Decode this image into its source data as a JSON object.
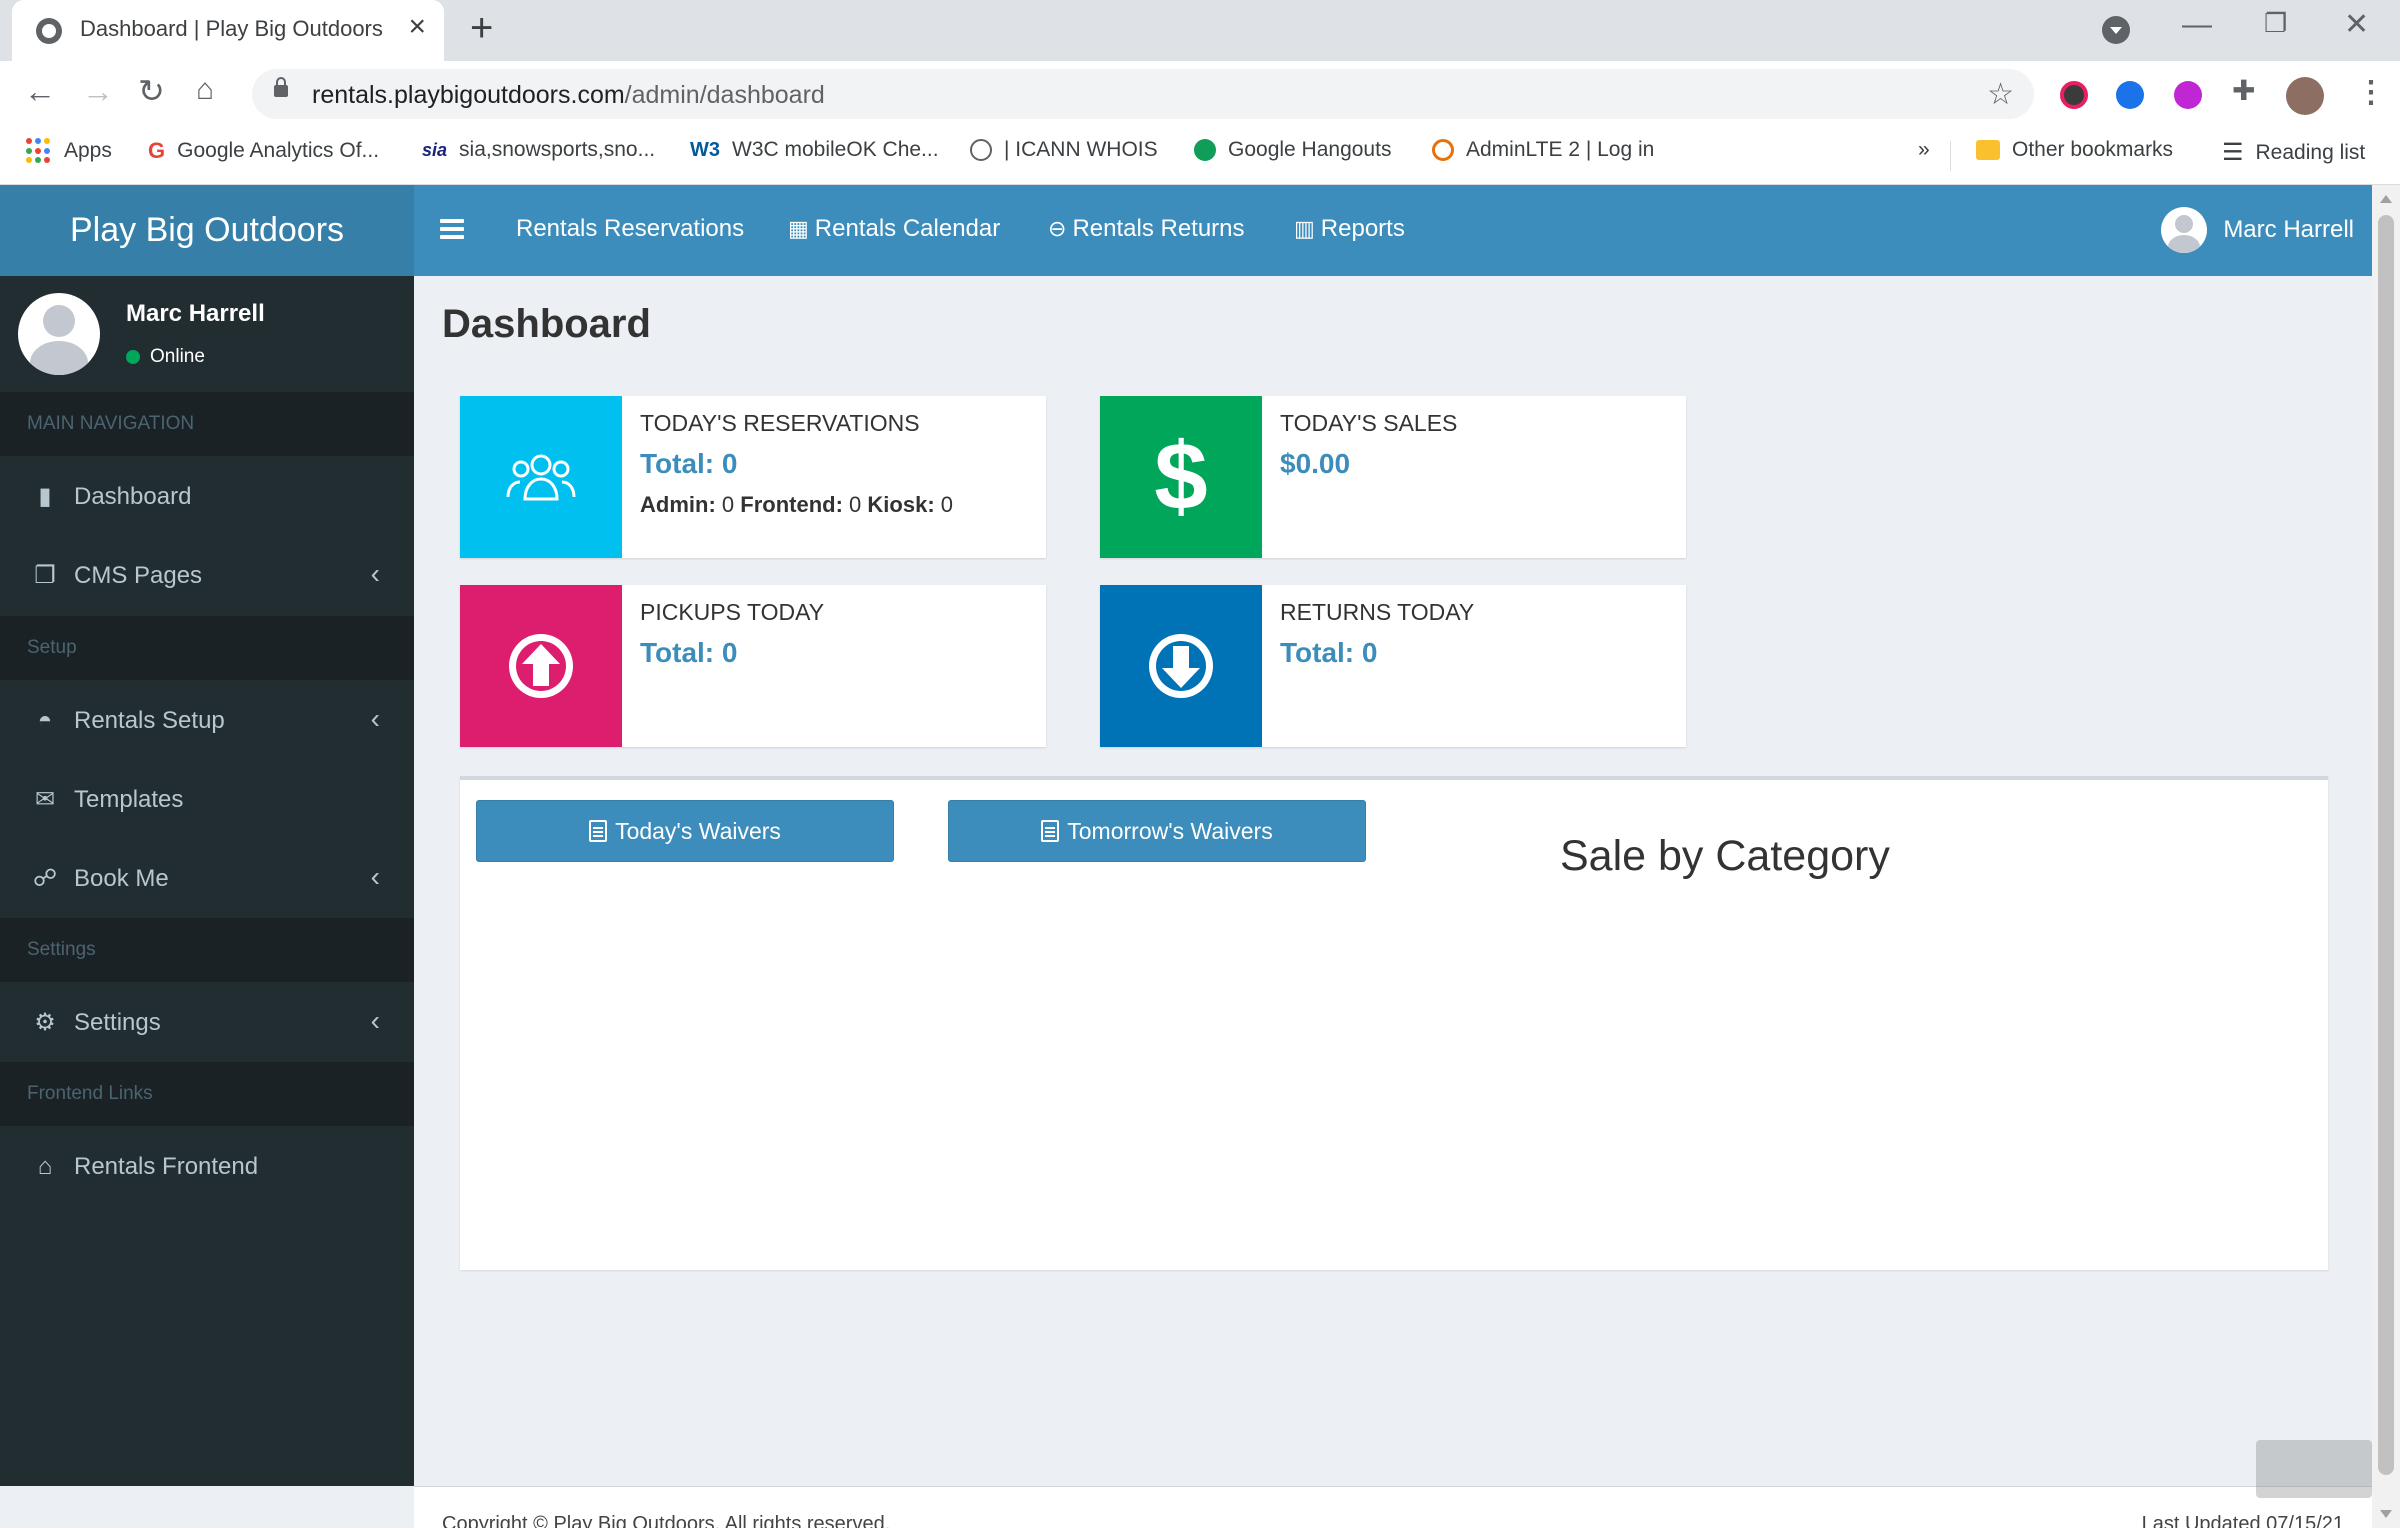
{
  "browser": {
    "tab_title": "Dashboard | Play Big Outdoors",
    "url_host": "rentals.playbigoutdoors.com",
    "url_path": "/admin/dashboard",
    "bookmarks": [
      {
        "label": "Apps",
        "icon": "apps-grid-icon"
      },
      {
        "label": "Google Analytics Of...",
        "icon": "google-icon"
      },
      {
        "label": "sia,snowsports,sno...",
        "icon": "sia-icon"
      },
      {
        "label": "W3C mobileOK Che...",
        "icon": "w3c-icon"
      },
      {
        "label": "| ICANN WHOIS",
        "icon": "icann-icon"
      },
      {
        "label": "Google Hangouts",
        "icon": "hangouts-icon"
      },
      {
        "label": "AdminLTE 2 | Log in",
        "icon": "adminlte-icon"
      }
    ],
    "overflow": "»",
    "other_bookmarks": "Other bookmarks",
    "reading_list": "Reading list"
  },
  "app": {
    "logo": "Play Big Outdoors",
    "topnav": [
      {
        "label": "Rentals Reservations",
        "icon": ""
      },
      {
        "label": "Rentals Calendar",
        "icon": "calendar-icon"
      },
      {
        "label": "Rentals Returns",
        "icon": "return-circle-icon"
      },
      {
        "label": "Reports",
        "icon": "bar-chart-icon"
      }
    ],
    "user_name": "Marc Harrell"
  },
  "sidebar": {
    "user_name": "Marc Harrell",
    "status": "Online",
    "sections": [
      {
        "header": "MAIN NAVIGATION",
        "items": [
          {
            "label": "Dashboard",
            "icon": "book-icon",
            "has_children": false
          },
          {
            "label": "CMS Pages",
            "icon": "copy-icon",
            "has_children": true
          }
        ]
      },
      {
        "header": "Setup",
        "items": [
          {
            "label": "Rentals Setup",
            "icon": "dashboard-gauge-icon",
            "has_children": true
          },
          {
            "label": "Templates",
            "icon": "envelope-icon",
            "has_children": false
          },
          {
            "label": "Book Me",
            "icon": "handshake-icon",
            "has_children": true
          }
        ]
      },
      {
        "header": "Settings",
        "items": [
          {
            "label": "Settings",
            "icon": "gear-icon",
            "has_children": true
          }
        ]
      },
      {
        "header": "Frontend Links",
        "items": [
          {
            "label": "Rentals Frontend",
            "icon": "home-icon",
            "has_children": false
          }
        ]
      }
    ]
  },
  "main": {
    "title": "Dashboard",
    "info_boxes": [
      {
        "label": "TODAY'S RESERVATIONS",
        "value": "Total: 0",
        "color": "#00c0ef",
        "icon": "users-icon",
        "breakdown": [
          {
            "key": "Admin:",
            "val": "0"
          },
          {
            "key": "Frontend:",
            "val": "0"
          },
          {
            "key": "Kiosk:",
            "val": "0"
          }
        ]
      },
      {
        "label": "TODAY'S SALES",
        "value": "$0.00",
        "color": "#00a65a",
        "icon": "dollar-icon"
      },
      {
        "label": "PICKUPS TODAY",
        "value": "Total: 0",
        "color": "#dd1e6e",
        "icon": "arrow-circle-up-icon"
      },
      {
        "label": "RETURNS TODAY",
        "value": "Total: 0",
        "color": "#0073b7",
        "icon": "arrow-circle-down-icon"
      }
    ],
    "buttons": {
      "todays_waivers": "Today's Waivers",
      "tomorrows_waivers": "Tomorrow's Waivers"
    },
    "chart_title": "Sale by Category"
  },
  "footer": {
    "left": "Copyright © Play Big Outdoors. All rights reserved.",
    "right": "Last Updated 07/15/21"
  }
}
